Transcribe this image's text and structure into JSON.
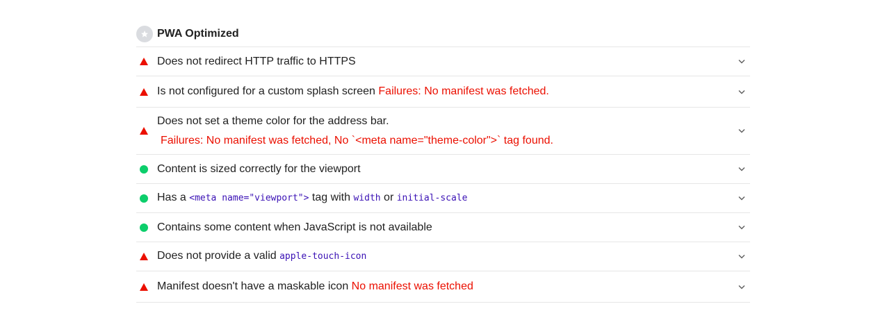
{
  "header": {
    "title": "PWA Optimized",
    "badge_icon": "star-icon",
    "badge_color": "#dadce0"
  },
  "colors": {
    "fail": "#eb0f00",
    "pass": "#0cce6b",
    "code": "#3a11b5",
    "text": "#212121",
    "divider": "#e6e6e6"
  },
  "audits": [
    {
      "status": "fail",
      "title": "Does not redirect HTTP traffic to HTTPS"
    },
    {
      "status": "fail",
      "title": "Is not configured for a custom splash screen",
      "failure": "Failures: No manifest was fetched."
    },
    {
      "status": "fail",
      "title": "Does not set a theme color for the address bar.",
      "failure": "Failures: No manifest was fetched, No `<meta name=\"theme-color\">` tag found."
    },
    {
      "status": "pass",
      "title": "Content is sized correctly for the viewport"
    },
    {
      "status": "pass",
      "parts": {
        "t1": "Has a ",
        "c1": "<meta name=\"viewport\">",
        "t2": " tag with ",
        "c2": "width",
        "t3": " or ",
        "c3": "initial-scale"
      }
    },
    {
      "status": "pass",
      "title": "Contains some content when JavaScript is not available"
    },
    {
      "status": "fail",
      "parts": {
        "t1": "Does not provide a valid ",
        "c1": "apple-touch-icon"
      }
    },
    {
      "status": "fail",
      "title": "Manifest doesn't have a maskable icon",
      "failure": "No manifest was fetched"
    }
  ]
}
